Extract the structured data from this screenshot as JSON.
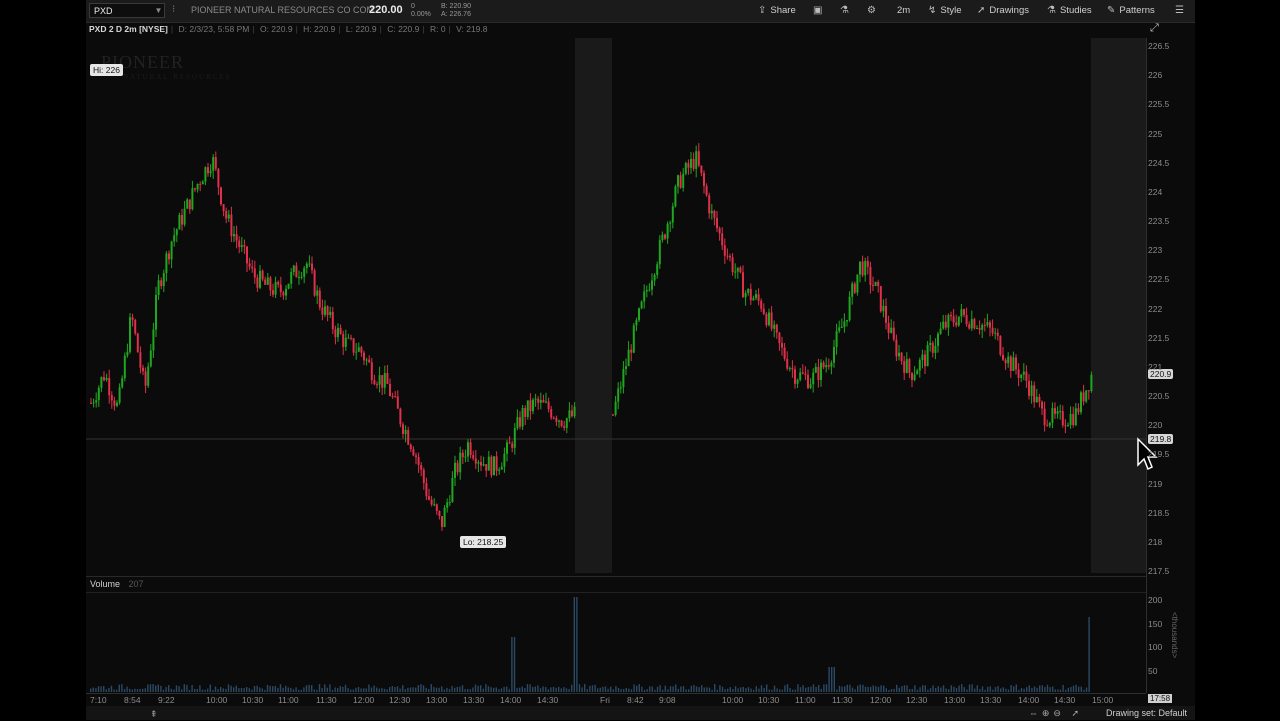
{
  "toolbar": {
    "symbol": "PXD",
    "company": "PIONEER NATURAL RESOURCES CO COM",
    "price": "220.00",
    "change": "0",
    "change_pct": "0.00%",
    "bid": "B: 220.90",
    "ask": "A: 226.76",
    "share_label": "Share",
    "timeframe_label": "2m",
    "style_label": "Style",
    "drawings_label": "Drawings",
    "studies_label": "Studies",
    "patterns_label": "Patterns"
  },
  "infobar": {
    "ticker": "PXD 2 D 2m [NYSE]",
    "date": "D: 2/3/23, 5:58 PM",
    "open": "O: 220.9",
    "high": "H: 220.9",
    "low": "L: 220.9",
    "close": "C: 220.9",
    "range": "R: 0",
    "volume": "V: 219.8"
  },
  "watermark": {
    "name": "PIONEER",
    "sub": "NATURAL RESOURCES"
  },
  "labels": {
    "hi": "Hi: 226",
    "lo": "Lo: 218.25",
    "last_price": "220.9",
    "crosshair_price": "219.8",
    "last_time": "17:58"
  },
  "volume": {
    "label": "Volume",
    "value": "207",
    "unit": "<thousands>"
  },
  "y_axis": [
    "226.5",
    "226",
    "225.5",
    "225",
    "224.5",
    "224",
    "223.5",
    "223",
    "222.5",
    "222",
    "221.5",
    "221",
    "220.5",
    "220",
    "219.5",
    "219",
    "218.5",
    "218",
    "217.5"
  ],
  "vol_axis": [
    "200",
    "150",
    "100",
    "50"
  ],
  "x_axis": [
    "7:10",
    "8:54",
    "9:22",
    "10:00",
    "10:30",
    "11:00",
    "11:30",
    "12:00",
    "12:30",
    "13:00",
    "13:30",
    "14:00",
    "14:30",
    "Fri",
    "8:42",
    "9:08",
    "10:00",
    "10:30",
    "11:00",
    "11:30",
    "12:00",
    "12:30",
    "13:00",
    "13:30",
    "14:00",
    "14:30",
    "15:00"
  ],
  "status": {
    "drawing_set": "Drawing set: Default"
  },
  "colors": {
    "up": "#1fa81f",
    "down": "#e0304a",
    "background": "#0b0b0b",
    "session_shade": "#1a1a1a"
  },
  "chart_data": {
    "type": "candlestick",
    "title": "",
    "ylim": [
      217.5,
      226.5
    ],
    "y": [
      220.4,
      220.9,
      220.3,
      221.9,
      220.6,
      222.4,
      223.2,
      223.7,
      224.2,
      224.6,
      223.6,
      223.1,
      222.6,
      222.4,
      222.3,
      222.6,
      222.8,
      222.1,
      221.7,
      221.4,
      221.3,
      220.9,
      220.7,
      220.1,
      219.6,
      218.8,
      218.3,
      219.2,
      219.7,
      219.4,
      219.3,
      219.6,
      220.2,
      220.4,
      220.3,
      220.1,
      220.2,
      221.3,
      222.3,
      223.2,
      224.2,
      224.6,
      223.6,
      222.9,
      222.3,
      222.1,
      221.4,
      220.9,
      220.8,
      221.1,
      221.8,
      222.8,
      222.3,
      221.4,
      220.9,
      221.2,
      221.7,
      221.9,
      221.8,
      221.6,
      221.1,
      220.8,
      220.2,
      220.1,
      220.2,
      220.9
    ]
  }
}
